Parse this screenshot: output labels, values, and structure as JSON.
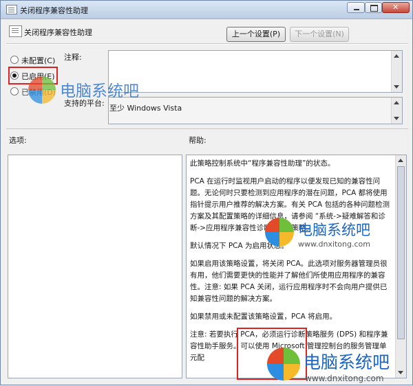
{
  "window": {
    "title": "关闭程序兼容性助理"
  },
  "header": {
    "title": "关闭程序兼容性助理",
    "prev_label": "上一个设置(P)",
    "next_label": "下一个设置(N)"
  },
  "radios": [
    {
      "label": "未配置(C)",
      "selected": false
    },
    {
      "label": "已启用(E)",
      "selected": true
    },
    {
      "label": "已禁用(D)",
      "selected": false
    }
  ],
  "labels": {
    "comment": "注释:",
    "support": "支持的平台:",
    "options": "选项:",
    "help": "帮助:"
  },
  "support_value": "至少 Windows Vista",
  "help_paragraphs": [
    "此策略控制系统中“程序兼容性助理”的状态。",
    "PCA 在运行时监视用户启动的程序以便发现已知的兼容性问题。无论何时只要检测到应用程序的潜在问题，PCA 都将使用指针提示用户推荐的解决方案。有关 PCA 包括的各种问题检测方案及其配置策略的详细信息，请参阅 “系统->疑难解答和诊断->应用程序兼容性诊断” 下的策略。",
    "默认情况下 PCA 为启用状态。",
    "如果启用该策略设置，将关闭 PCA。此选项对服务器管理员很有用，他们需要更快的性能并了解他们所使用应用程序的兼容性。注意: 如果 PCA 关闭，运行应用程序时不会向用户提供已知兼容性问题的解决方案。",
    "如果禁用或未配置该策略设置，PCA 将启用。",
    "注意: 若要执行 PCA，必须运行诊断策略服务 (DPS) 和程序兼容性助手服务。可以使用 Microsoft 管理控制台的服务管理单元配"
  ],
  "watermark": {
    "name": "电脑系统吧",
    "url": "www.dnxitong.com"
  }
}
